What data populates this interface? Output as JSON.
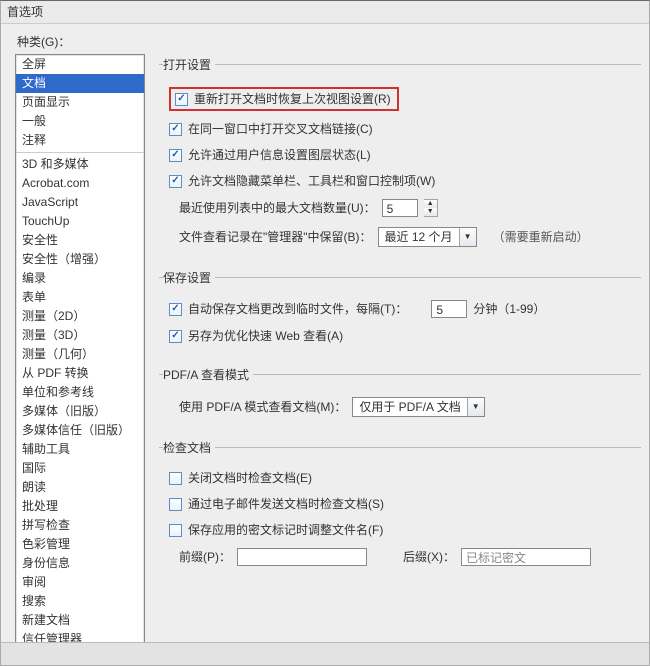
{
  "window": {
    "title": "首选项"
  },
  "sidebar": {
    "label": "种类(G)：",
    "items": [
      "全屏",
      "文档",
      "页面显示",
      "一般",
      "注释",
      "-",
      "3D 和多媒体",
      "Acrobat.com",
      "JavaScript",
      "TouchUp",
      "安全性",
      "安全性（增强）",
      "编录",
      "表单",
      "测量（2D）",
      "测量（3D）",
      "测量（几何）",
      "从 PDF 转换",
      "单位和参考线",
      "多媒体（旧版）",
      "多媒体信任（旧版）",
      "辅助工具",
      "国际",
      "朗读",
      "批处理",
      "拼写检查",
      "色彩管理",
      "身份信息",
      "审阅",
      "搜索",
      "新建文档",
      "信任管理器"
    ],
    "selected_index": 1
  },
  "open_settings": {
    "legend": "打开设置",
    "restore_last_view": "重新打开文档时恢复上次视图设置(R)",
    "cross_doc_same_window": "在同一窗口中打开交叉文档链接(C)",
    "allow_layer_state": "允许通过用户信息设置图层状态(L)",
    "allow_hide_menubar": "允许文档隐藏菜单栏、工具栏和窗口控制项(W)",
    "recent_docs_label": "最近使用列表中的最大文档数量(U)：",
    "recent_docs_value": "5",
    "history_label": "文件查看记录在\"管理器\"中保留(B)：",
    "history_value": "最近 12 个月",
    "history_hint": "（需要重新启动）"
  },
  "save_settings": {
    "legend": "保存设置",
    "autosave_label": "自动保存文档更改到临时文件，每隔(T)：",
    "autosave_value": "5",
    "autosave_unit": "分钟（1-99）",
    "save_optimized_web": "另存为优化快速 Web 查看(A)"
  },
  "pdfa": {
    "legend": "PDF/A 查看模式",
    "mode_label": "使用 PDF/A 模式查看文档(M)：",
    "mode_value": "仅用于 PDF/A 文档"
  },
  "examine": {
    "legend": "检查文档",
    "on_close": "关闭文档时检查文档(E)",
    "on_email": "通过电子邮件发送文档时检查文档(S)",
    "on_save_redaction": "保存应用的密文标记时调整文件名(F)",
    "prefix_label": "前缀(P)：",
    "suffix_label": "后缀(X)：",
    "suffix_placeholder": "已标记密文"
  }
}
